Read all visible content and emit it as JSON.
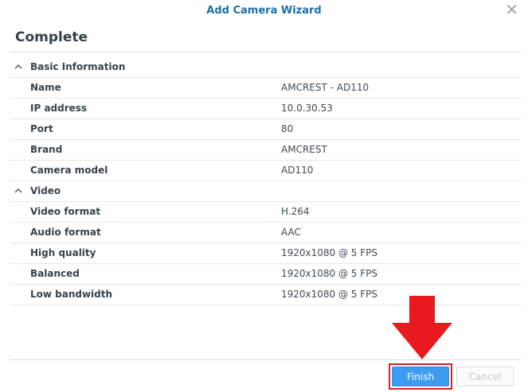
{
  "dialog": {
    "title": "Add Camera Wizard",
    "close_symbol": "✕",
    "heading": "Complete"
  },
  "sections": [
    {
      "title": "Basic Information",
      "rows": [
        {
          "label": "Name",
          "value": "AMCREST - AD110"
        },
        {
          "label": "IP address",
          "value": "10.0.30.53"
        },
        {
          "label": "Port",
          "value": "80"
        },
        {
          "label": "Brand",
          "value": "AMCREST"
        },
        {
          "label": "Camera model",
          "value": "AD110"
        }
      ]
    },
    {
      "title": "Video",
      "rows": [
        {
          "label": "Video format",
          "value": "H.264"
        },
        {
          "label": "Audio format",
          "value": "AAC"
        },
        {
          "label": "High quality",
          "value": "1920x1080 @ 5 FPS"
        },
        {
          "label": "Balanced",
          "value": "1920x1080 @ 5 FPS"
        },
        {
          "label": "Low bandwidth",
          "value": "1920x1080 @ 5 FPS"
        }
      ]
    }
  ],
  "buttons": {
    "finish": "Finish",
    "cancel": "Cancel"
  },
  "colors": {
    "accent": "#3d9cf0",
    "title": "#1b6fad",
    "annotation": "#e8191f"
  }
}
